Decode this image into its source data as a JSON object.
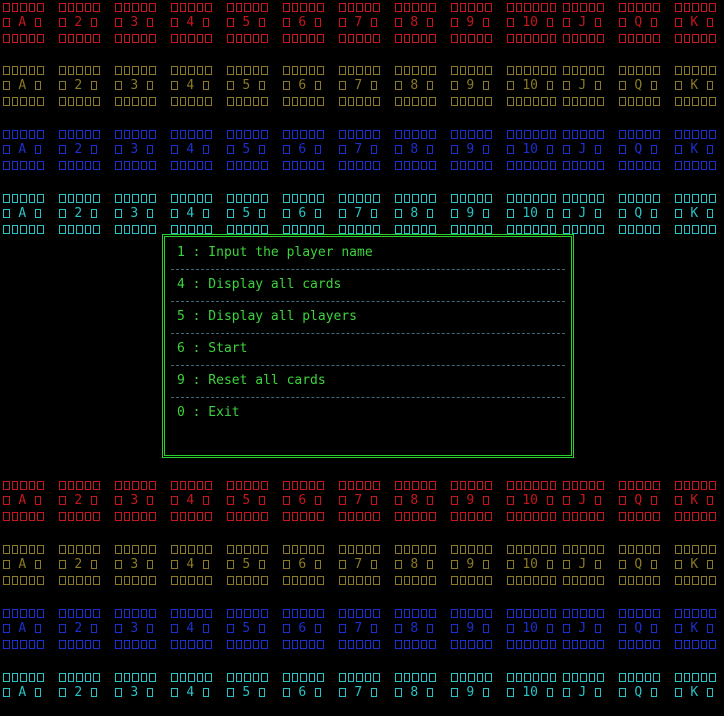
{
  "ranks": [
    "A",
    "2",
    "3",
    "4",
    "5",
    "6",
    "7",
    "8",
    "9",
    "10",
    "J",
    "Q",
    "K"
  ],
  "suit_colors": {
    "red": "#c8161d",
    "yellow": "#8a7a23",
    "blue": "#1c2fd0",
    "cyan": "#27c3c6"
  },
  "card_rows": [
    {
      "color": "red"
    },
    {
      "color": "yellow"
    },
    {
      "color": "blue"
    },
    {
      "color": "cyan"
    },
    {
      "color": "red"
    },
    {
      "color": "yellow"
    },
    {
      "color": "blue"
    },
    {
      "color": "cyan"
    }
  ],
  "menu": {
    "items": [
      {
        "label": "1 : Input the player name"
      },
      {
        "label": "4 : Display all cards"
      },
      {
        "label": "5 : Display all players"
      },
      {
        "label": "6 : Start"
      },
      {
        "label": "9 : Reset all cards"
      },
      {
        "label": "0 : Exit"
      }
    ]
  }
}
